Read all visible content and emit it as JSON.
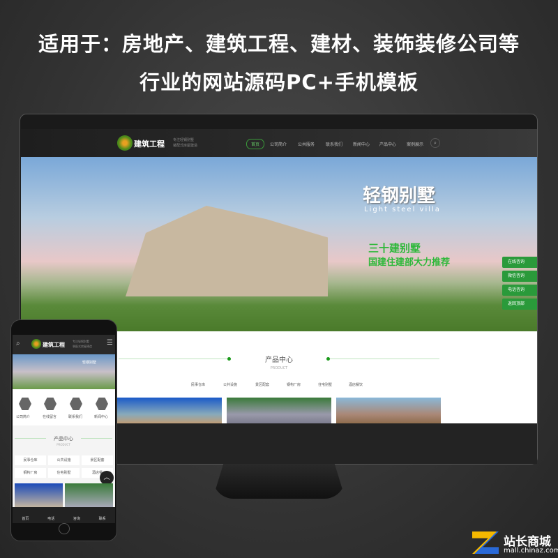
{
  "headline": {
    "line1": "适用于：房地产、建筑工程、建材、装饰装修公司等",
    "line2": "行业的网站源码PC+手机模板"
  },
  "desktop": {
    "logo": {
      "name": "建筑工程",
      "slogan1": "专注轻钢别墅",
      "slogan2": "装配式房屋建造"
    },
    "nav": [
      "首页",
      "公司简介",
      "公共服务",
      "联系我们",
      "新闻中心",
      "产品中心",
      "案例展示"
    ],
    "search_icon": "search-icon",
    "banner": {
      "title": "轻钢别墅",
      "subtitle": "Light steel villa",
      "line1": "三十建别墅",
      "line2": "国建住建部大力推荐"
    },
    "side_buttons": [
      "在线咨询",
      "微信咨询",
      "电话咨询",
      "返回顶部"
    ],
    "section": {
      "title": "产品中心",
      "subtitle": "PRODUCT",
      "tabs": [
        "民事仓库",
        "公共设施",
        "景区配套",
        "钢构厂房",
        "住宅别墅",
        "酒店餐饮"
      ]
    }
  },
  "mobile": {
    "logo": {
      "name": "建筑工程",
      "slogan1": "专注轻钢别墅",
      "slogan2": "装配式房屋建造"
    },
    "banner_title": "轻钢别墅",
    "icons": [
      {
        "label": "公司简介",
        "icon": "building-icon"
      },
      {
        "label": "在线留言",
        "icon": "message-icon"
      },
      {
        "label": "联系我们",
        "icon": "contact-icon"
      },
      {
        "label": "新闻中心",
        "icon": "handshake-icon"
      }
    ],
    "section": {
      "title": "产品中心",
      "subtitle": "PRODUCT"
    },
    "categories": [
      "民事仓库",
      "公共设施",
      "景区配套",
      "钢构厂房",
      "住宅别墅",
      "酒店餐"
    ],
    "bottom_nav": [
      "首页",
      "电话",
      "咨询",
      "联系"
    ]
  },
  "watermark": {
    "name": "站长商城",
    "url": "mall.chinaz.com"
  },
  "colors": {
    "accent": "#2a9a3a",
    "background": "#333333"
  }
}
